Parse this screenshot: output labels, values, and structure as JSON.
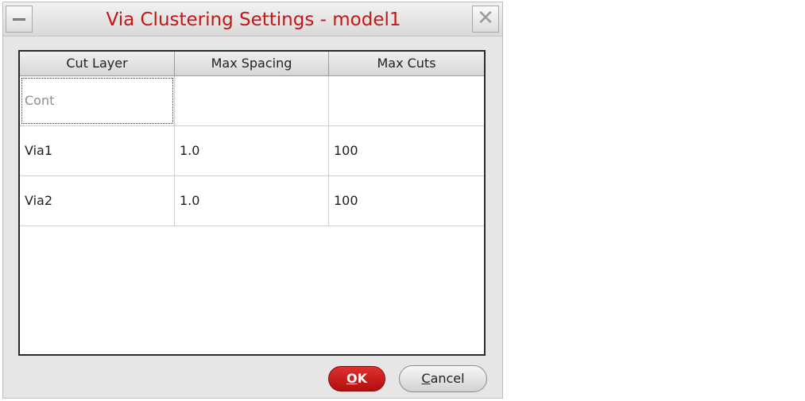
{
  "window": {
    "title": "Via Clustering Settings - model1",
    "menu_icon": "window-menu-icon",
    "close_icon": "close-icon",
    "close_glyph": "✕"
  },
  "table": {
    "headers": [
      "Cut Layer",
      "Max Spacing",
      "Max Cuts"
    ],
    "rows": [
      [
        "Cont",
        "",
        ""
      ],
      [
        "Via1",
        "1.0",
        "100"
      ],
      [
        "Via2",
        "1.0",
        "100"
      ]
    ]
  },
  "buttons": {
    "ok": {
      "mnemonic": "O",
      "rest": "K"
    },
    "cancel": {
      "mnemonic": "C",
      "rest": "ancel"
    }
  },
  "colors": {
    "title": "#c41616",
    "ok_button": "#c41616"
  }
}
